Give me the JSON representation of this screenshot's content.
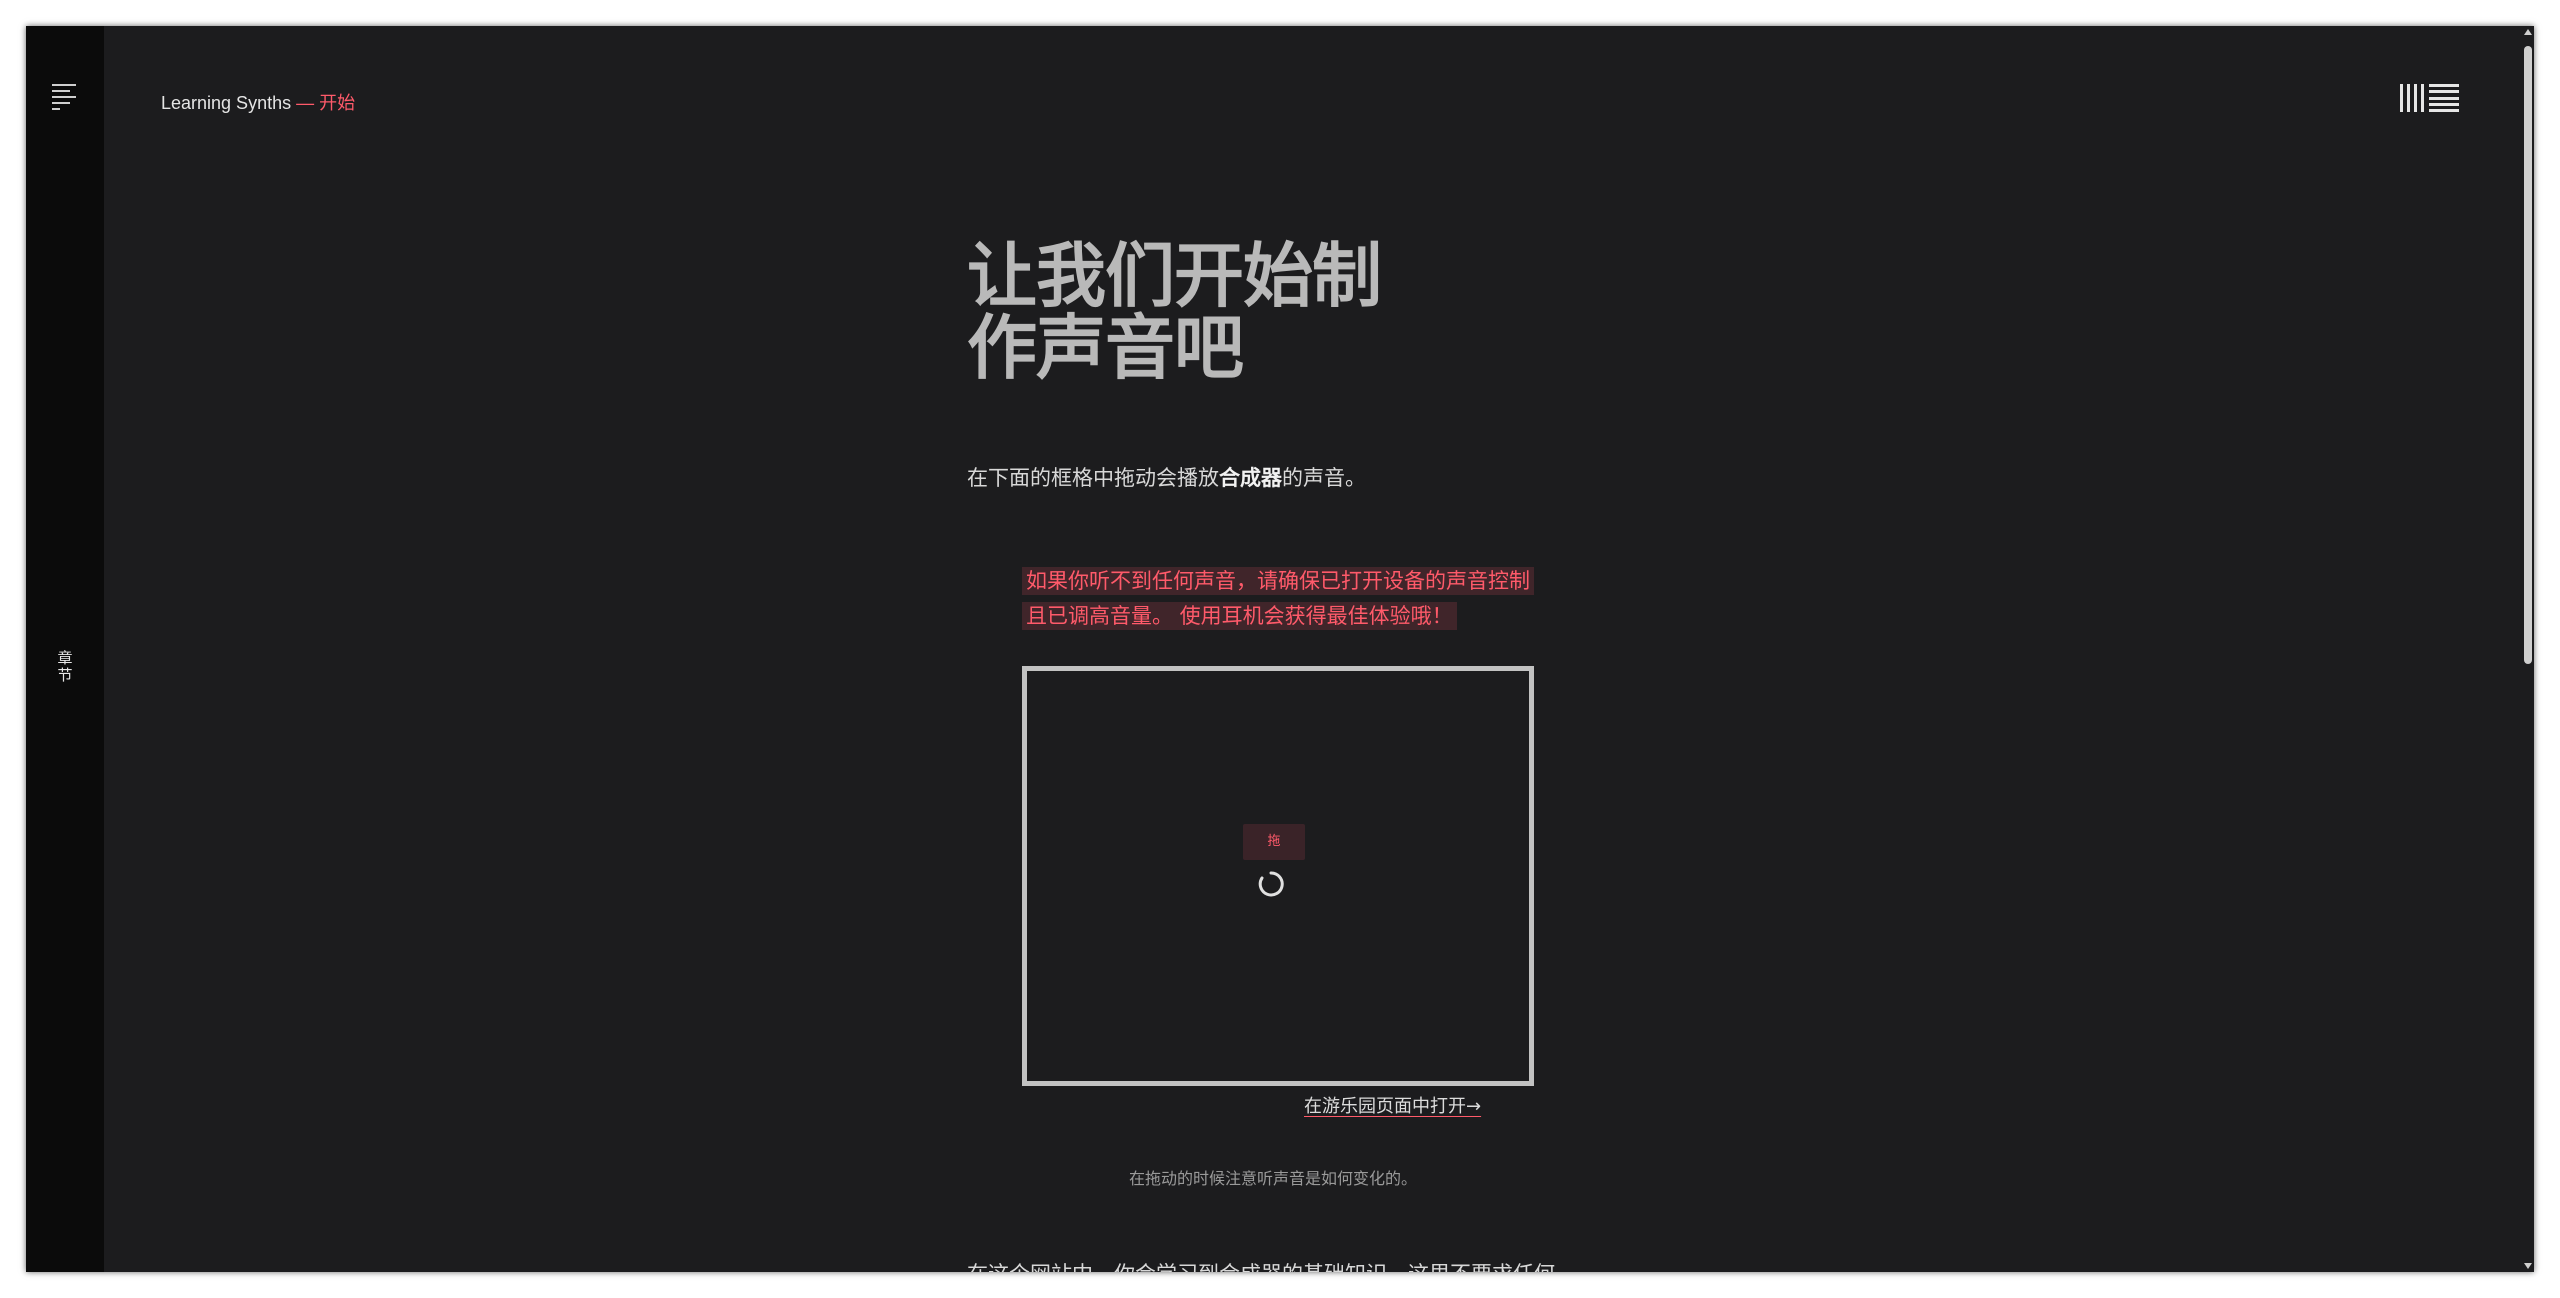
{
  "sidebar": {
    "chapters_label_chars": [
      "章",
      "节"
    ]
  },
  "header": {
    "site_name": "Learning Synths",
    "separator": "—",
    "current_page": "开始"
  },
  "main": {
    "title": "让我们开始制作声音吧",
    "intro_before": "在下面的框格中拖动会播放",
    "intro_bold": "合成器",
    "intro_after": "的声音。",
    "warning": "如果你听不到任何声音，请确保已打开设备的声音控制且已调高音量。 使用耳机会获得最佳体验哦！",
    "pad": {
      "drag_label": "拖"
    },
    "open_in_playground": "在游乐园页面中打开→",
    "caption": "在拖动的时候注意听声音是如何变化的。",
    "next_paragraph": "在这个网站中，你会学习到合成器的基础知识。这里不要求任何"
  },
  "colors": {
    "background": "#1c1c1e",
    "sidebar": "#0b0b0b",
    "accent": "#ff5a6a",
    "title": "#b9b9b9"
  },
  "icons": [
    "menu-lines-icon",
    "logo-bars-icon",
    "drag-ring-icon"
  ]
}
